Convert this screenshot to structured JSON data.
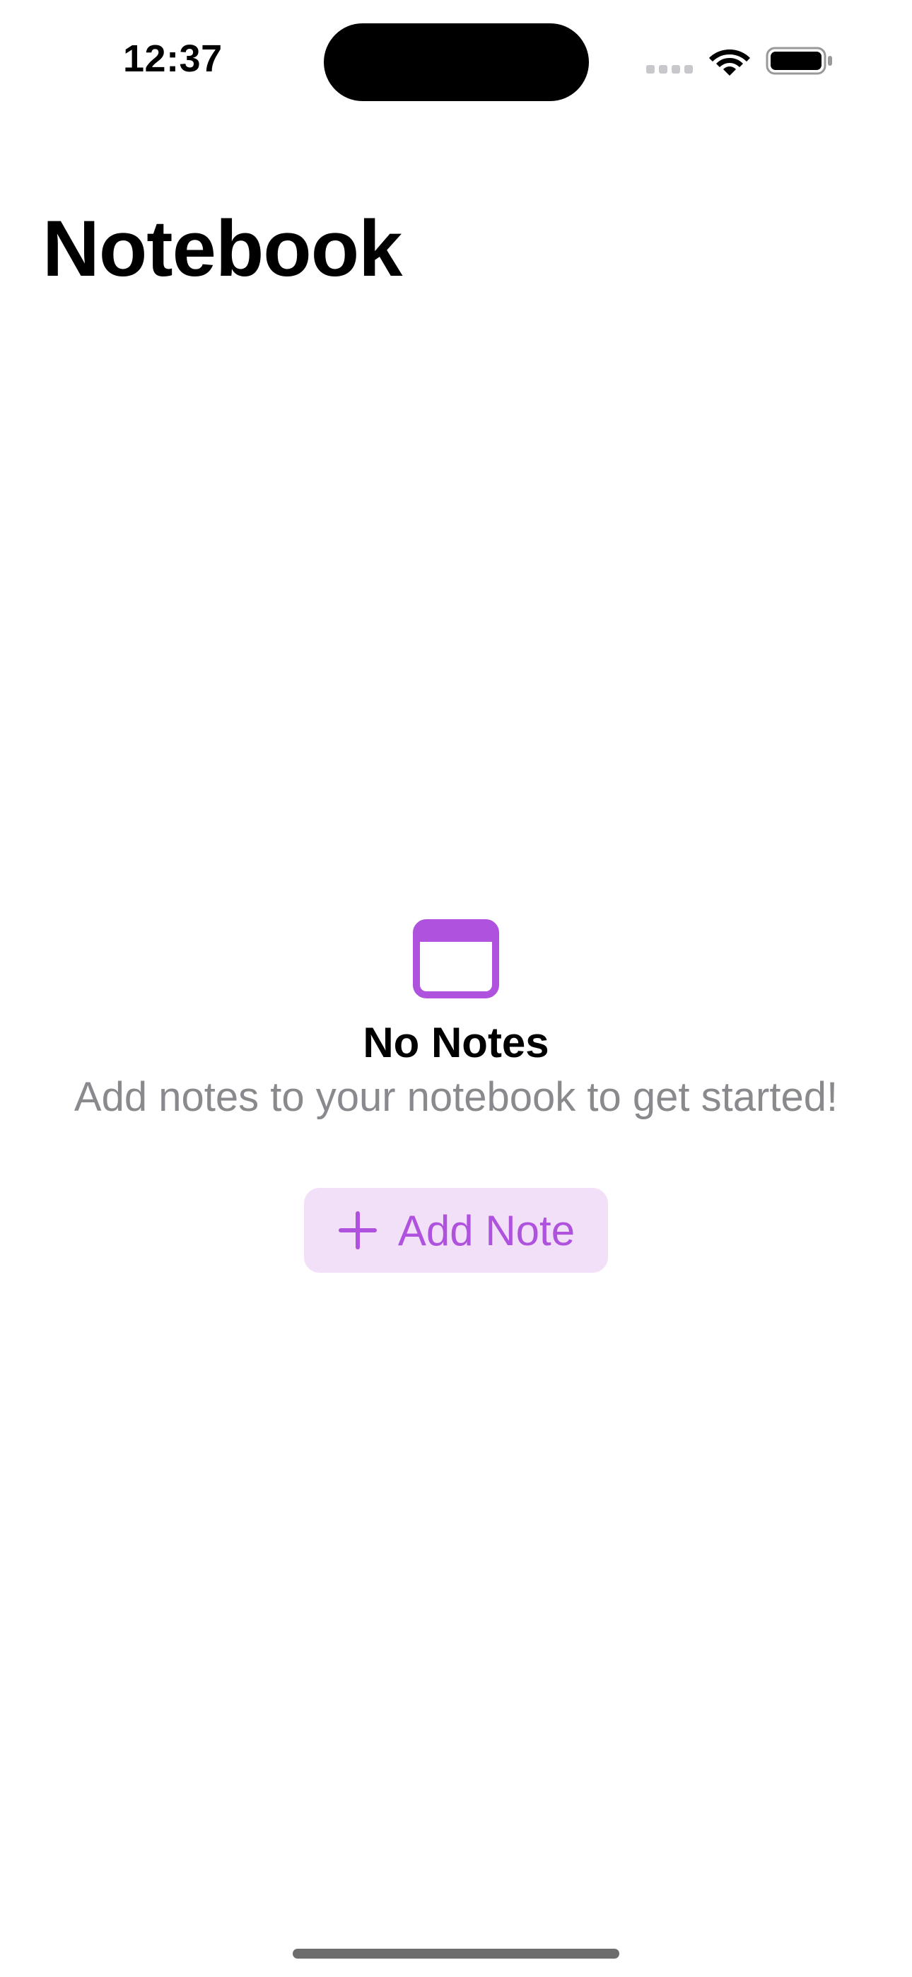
{
  "status_bar": {
    "time": "12:37",
    "icons": [
      "cellular-signal-icon",
      "wifi-icon",
      "battery-icon"
    ]
  },
  "header": {
    "title": "Notebook"
  },
  "empty_state": {
    "icon": "notes-window-icon",
    "title": "No Notes",
    "subtitle": "Add notes to your notebook to get started!",
    "button_label": "Add Note",
    "button_icon": "plus-icon"
  },
  "colors": {
    "accent": "#af52de",
    "accent_background": "#f1e0f7",
    "secondary_text": "#8a8a8e"
  }
}
